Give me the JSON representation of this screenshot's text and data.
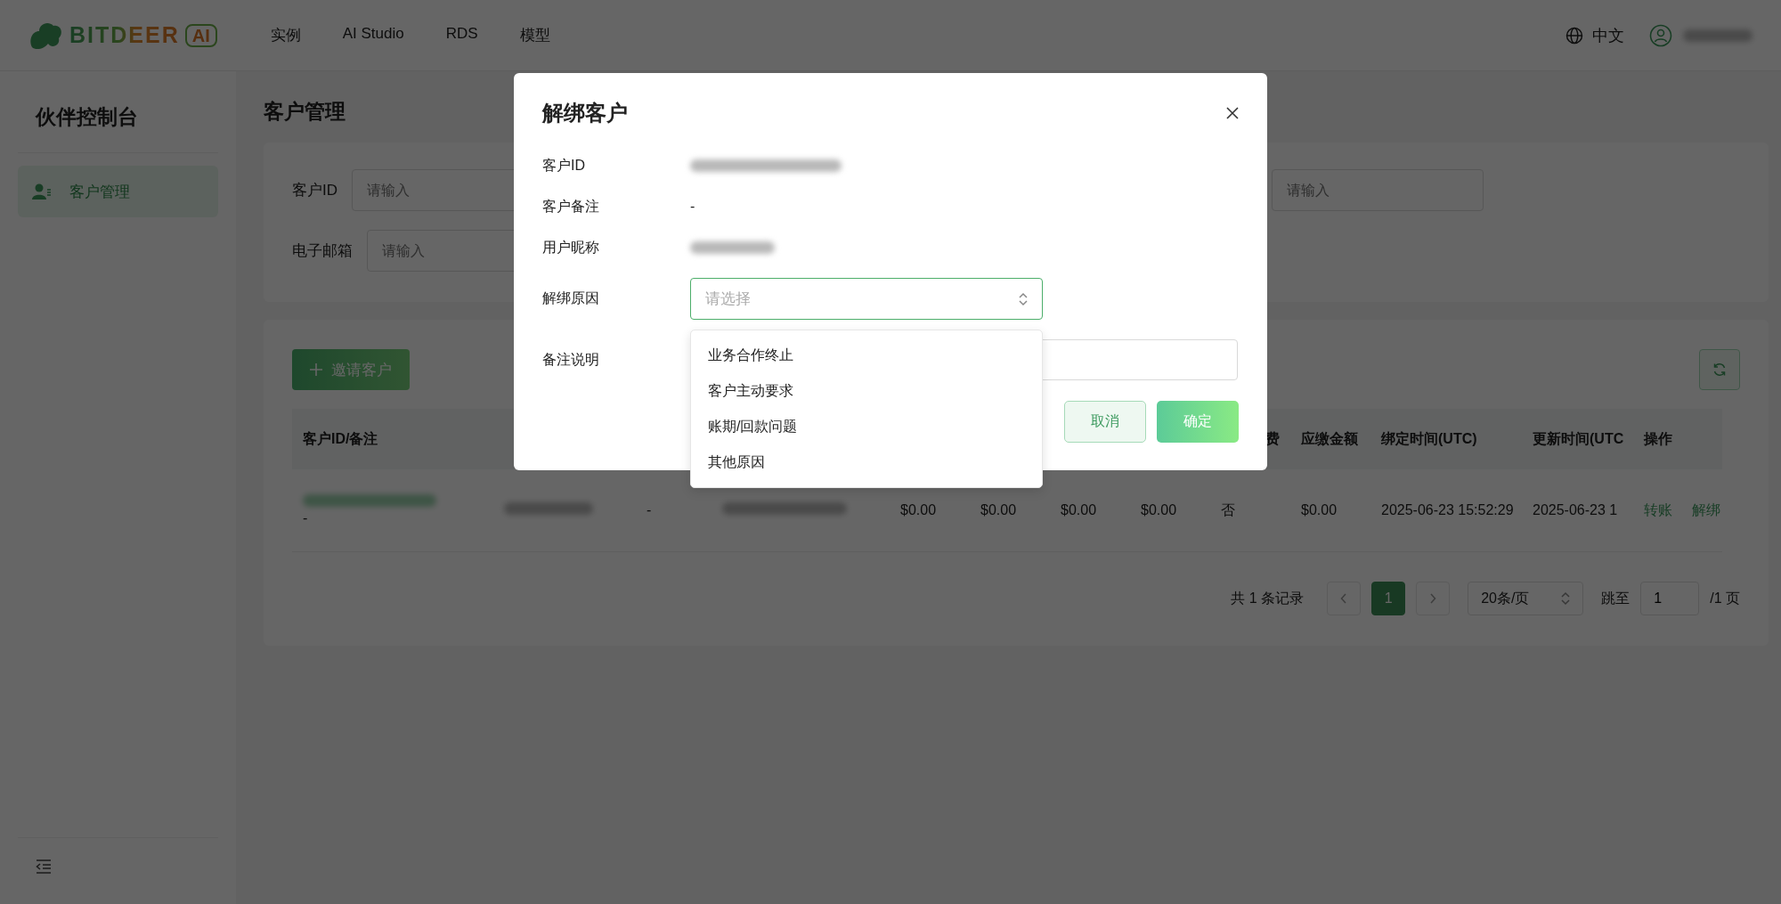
{
  "header": {
    "logo_word": "BITDEER",
    "logo_badge": "AI",
    "nav": [
      {
        "label": "实例"
      },
      {
        "label": "AI Studio"
      },
      {
        "label": "RDS"
      },
      {
        "label": "模型"
      }
    ],
    "language": "中文"
  },
  "sidebar": {
    "title": "伙伴控制台",
    "items": [
      {
        "label": "客户管理",
        "selected": true
      }
    ]
  },
  "page_title": "客户管理",
  "filters": [
    [
      {
        "label": "客户ID",
        "placeholder": "请输入"
      },
      {
        "placeholder": "请输入"
      }
    ],
    [
      {
        "label": "电子邮箱",
        "placeholder": "请输入"
      }
    ]
  ],
  "invite_button": "邀请客户",
  "table": {
    "columns": [
      {
        "label": "客户ID/备注"
      },
      {},
      {},
      {},
      {},
      {},
      {},
      {},
      {
        "label": "费"
      },
      {
        "label": "应缴金额"
      },
      {
        "label": "绑定时间(UTC)"
      },
      {
        "label": "更新时间(UTC"
      },
      {
        "label": "操作"
      }
    ],
    "rows": [
      {
        "cells": [
          {
            "kind": "blurred_link",
            "note": "-"
          },
          {
            "kind": "blurred"
          },
          {
            "kind": "text",
            "text": "-"
          },
          {
            "kind": "blurred"
          },
          {
            "kind": "text",
            "text": "$0.00"
          },
          {
            "kind": "text",
            "text": "$0.00"
          },
          {
            "kind": "text",
            "text": "$0.00"
          },
          {
            "kind": "text",
            "text": "$0.00"
          },
          {
            "kind": "text",
            "text": "否"
          },
          {
            "kind": "text",
            "text": "$0.00"
          },
          {
            "kind": "text",
            "text": "2025-06-23 15:52:29"
          },
          {
            "kind": "text",
            "text": "2025-06-23 1"
          },
          {
            "kind": "actions",
            "actions": [
              "转账",
              "解绑"
            ]
          }
        ]
      }
    ]
  },
  "pagination": {
    "total": "共 1 条记录",
    "pages": [
      {
        "label": "1",
        "selected": true
      }
    ],
    "page_size": "20条/页",
    "jump_label": "跳至",
    "jump_value": "1",
    "page_count": "/1 页"
  },
  "dialog": {
    "title": "解绑客户",
    "fields": [
      {
        "label": "客户ID",
        "kind": "blurred"
      },
      {
        "label": "客户备注",
        "kind": "text",
        "value": "-"
      },
      {
        "label": "用户昵称",
        "kind": "blurred"
      },
      {
        "label": "解绑原因",
        "kind": "select",
        "placeholder": "请选择"
      },
      {
        "label": "备注说明",
        "kind": "input"
      }
    ],
    "dropdown": [
      {
        "label": "业务合作终止",
        "selected": false
      },
      {
        "label": "客户主动要求",
        "selected": false
      },
      {
        "label": "账期/回款问题",
        "selected": false
      },
      {
        "label": "其他原因",
        "selected": false
      }
    ],
    "buttons": [
      {
        "label": "取消",
        "kind": "secondary"
      },
      {
        "label": "确定",
        "kind": "primary"
      }
    ]
  }
}
